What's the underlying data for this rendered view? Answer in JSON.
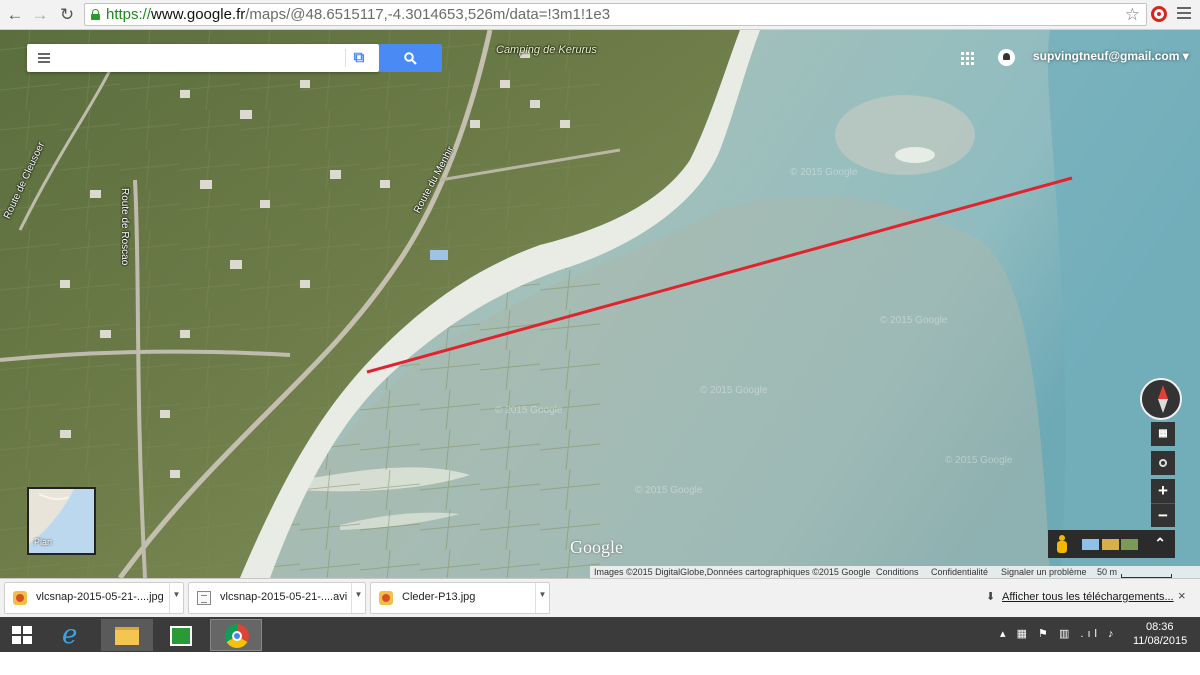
{
  "browser": {
    "url_https": "https://",
    "url_host": "www.google.fr",
    "url_path": "/maps/@48.6515117,-4.3014653,526m/data=!3m1!1e3"
  },
  "maps": {
    "search_placeholder": "",
    "account": "supvingtneuf@gmail.com ▾",
    "labels": {
      "camping": "Camping de Kerurus",
      "cleusoer": "Route de Cleusoer",
      "roscao": "Route de Roscao",
      "menhir": "Route du Menhir"
    },
    "watermark": "© 2015 Google",
    "thumbnail_label": "Plan",
    "logo": "Google",
    "attribution": {
      "imagery": "Images ©2015 DigitalGlobe,Données cartographiques ©2015 Google",
      "terms": "Conditions",
      "privacy": "Confidentialité",
      "report": "Signaler un problème",
      "scale": "50 m"
    },
    "colors": {
      "search_blue": "#4a8af4",
      "route_line": "#e0232d"
    }
  },
  "downloads": {
    "items": [
      {
        "name": "vlcsnap-2015-05-21-....jpg",
        "icon": "jpg-file-icon"
      },
      {
        "name": "vlcsnap-2015-05-21-....avi",
        "icon": "avi-file-icon"
      },
      {
        "name": "Cleder-P13.jpg",
        "icon": "jpg-file-icon"
      }
    ],
    "show_all": "Afficher tous les téléchargements...",
    "close": "×"
  },
  "taskbar": {
    "time": "08:36",
    "date": "11/08/2015"
  }
}
